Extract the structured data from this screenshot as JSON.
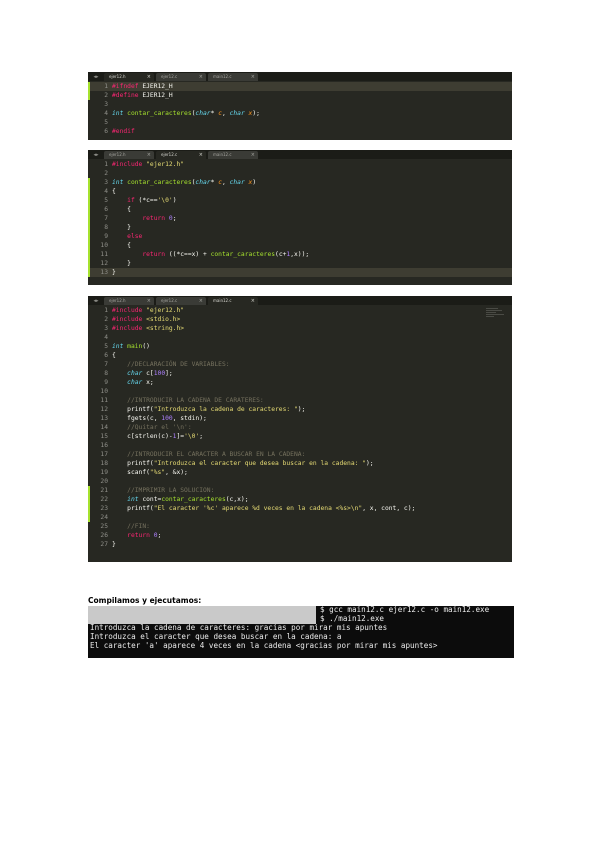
{
  "editors": [
    {
      "tabs": [
        {
          "label": "ejer12.h",
          "active": true
        },
        {
          "label": "ejer12.c",
          "active": false
        },
        {
          "label": "main12.c",
          "active": false
        }
      ],
      "lines": [
        {
          "n": "1",
          "tokens": [
            {
              "t": "#ifndef ",
              "c": "kw"
            },
            {
              "t": "EJER12_H",
              "c": ""
            }
          ]
        },
        {
          "n": "2",
          "tokens": [
            {
              "t": "#define ",
              "c": "kw"
            },
            {
              "t": "EJER12_H",
              "c": ""
            }
          ]
        },
        {
          "n": "3",
          "tokens": []
        },
        {
          "n": "4",
          "tokens": [
            {
              "t": "int ",
              "c": "ty"
            },
            {
              "t": "contar_caracteres",
              "c": "fn"
            },
            {
              "t": "(",
              "c": ""
            },
            {
              "t": "char",
              "c": "ty"
            },
            {
              "t": "* ",
              "c": ""
            },
            {
              "t": "c",
              "c": "pa"
            },
            {
              "t": ", ",
              "c": ""
            },
            {
              "t": "char ",
              "c": "ty"
            },
            {
              "t": "x",
              "c": "pa"
            },
            {
              "t": ");",
              "c": ""
            }
          ]
        },
        {
          "n": "5",
          "tokens": []
        },
        {
          "n": "6",
          "tokens": [
            {
              "t": "#endif",
              "c": "kw"
            }
          ]
        }
      ]
    },
    {
      "tabs": [
        {
          "label": "ejer12.h",
          "active": false
        },
        {
          "label": "ejer12.c",
          "active": true
        },
        {
          "label": "main12.c",
          "active": false
        }
      ],
      "lines": [
        {
          "n": "1",
          "tokens": [
            {
              "t": "#include ",
              "c": "kw"
            },
            {
              "t": "\"ejer12.h\"",
              "c": "st"
            }
          ]
        },
        {
          "n": "2",
          "tokens": []
        },
        {
          "n": "3",
          "tokens": [
            {
              "t": "int ",
              "c": "ty"
            },
            {
              "t": "contar_caracteres",
              "c": "fn"
            },
            {
              "t": "(",
              "c": ""
            },
            {
              "t": "char",
              "c": "ty"
            },
            {
              "t": "* ",
              "c": ""
            },
            {
              "t": "c",
              "c": "pa"
            },
            {
              "t": ", ",
              "c": ""
            },
            {
              "t": "char ",
              "c": "ty"
            },
            {
              "t": "x",
              "c": "pa"
            },
            {
              "t": ")",
              "c": ""
            }
          ]
        },
        {
          "n": "4",
          "tokens": [
            {
              "t": "{",
              "c": ""
            }
          ]
        },
        {
          "n": "5",
          "tokens": [
            {
              "t": "    ",
              "c": ""
            },
            {
              "t": "if ",
              "c": "kw"
            },
            {
              "t": "(*c==",
              "c": ""
            },
            {
              "t": "'\\0'",
              "c": "st"
            },
            {
              "t": ")",
              "c": ""
            }
          ]
        },
        {
          "n": "6",
          "tokens": [
            {
              "t": "    {",
              "c": ""
            }
          ]
        },
        {
          "n": "7",
          "tokens": [
            {
              "t": "        ",
              "c": ""
            },
            {
              "t": "return ",
              "c": "kw"
            },
            {
              "t": "0",
              "c": "nu"
            },
            {
              "t": ";",
              "c": ""
            }
          ]
        },
        {
          "n": "8",
          "tokens": [
            {
              "t": "    }",
              "c": ""
            }
          ]
        },
        {
          "n": "9",
          "tokens": [
            {
              "t": "    ",
              "c": ""
            },
            {
              "t": "else",
              "c": "kw"
            }
          ]
        },
        {
          "n": "10",
          "tokens": [
            {
              "t": "    {",
              "c": ""
            }
          ]
        },
        {
          "n": "11",
          "tokens": [
            {
              "t": "        ",
              "c": ""
            },
            {
              "t": "return ",
              "c": "kw"
            },
            {
              "t": "((*c==x) + ",
              "c": ""
            },
            {
              "t": "contar_caracteres",
              "c": "fn"
            },
            {
              "t": "(c+",
              "c": ""
            },
            {
              "t": "1",
              "c": "nu"
            },
            {
              "t": ",x));",
              "c": ""
            }
          ]
        },
        {
          "n": "12",
          "tokens": [
            {
              "t": "    }",
              "c": ""
            }
          ]
        },
        {
          "n": "13",
          "tokens": [
            {
              "t": "}",
              "c": ""
            }
          ]
        }
      ]
    },
    {
      "tabs": [
        {
          "label": "ejer12.h",
          "active": false
        },
        {
          "label": "ejer12.c",
          "active": false
        },
        {
          "label": "main12.c",
          "active": true
        }
      ],
      "lines": [
        {
          "n": "1",
          "tokens": [
            {
              "t": "#include ",
              "c": "kw"
            },
            {
              "t": "\"ejer12.h\"",
              "c": "st"
            }
          ]
        },
        {
          "n": "2",
          "tokens": [
            {
              "t": "#include ",
              "c": "kw"
            },
            {
              "t": "<stdio.h>",
              "c": "st"
            }
          ]
        },
        {
          "n": "3",
          "tokens": [
            {
              "t": "#include ",
              "c": "kw"
            },
            {
              "t": "<string.h>",
              "c": "st"
            }
          ]
        },
        {
          "n": "4",
          "tokens": []
        },
        {
          "n": "5",
          "tokens": [
            {
              "t": "int ",
              "c": "ty"
            },
            {
              "t": "main",
              "c": "fn"
            },
            {
              "t": "()",
              "c": ""
            }
          ]
        },
        {
          "n": "6",
          "tokens": [
            {
              "t": "{",
              "c": ""
            }
          ]
        },
        {
          "n": "7",
          "tokens": [
            {
              "t": "    ",
              "c": ""
            },
            {
              "t": "//DECLARACIÓN DE VARIABLES:",
              "c": "cm"
            }
          ]
        },
        {
          "n": "8",
          "tokens": [
            {
              "t": "    ",
              "c": ""
            },
            {
              "t": "char ",
              "c": "ty"
            },
            {
              "t": "c[",
              "c": ""
            },
            {
              "t": "100",
              "c": "nu"
            },
            {
              "t": "];",
              "c": ""
            }
          ]
        },
        {
          "n": "9",
          "tokens": [
            {
              "t": "    ",
              "c": ""
            },
            {
              "t": "char ",
              "c": "ty"
            },
            {
              "t": "x;",
              "c": ""
            }
          ]
        },
        {
          "n": "10",
          "tokens": []
        },
        {
          "n": "11",
          "tokens": [
            {
              "t": "    ",
              "c": ""
            },
            {
              "t": "//INTRODUCIR LA CADENA DE CARATERES:",
              "c": "cm"
            }
          ]
        },
        {
          "n": "12",
          "tokens": [
            {
              "t": "    printf(",
              "c": ""
            },
            {
              "t": "\"Introduzca la cadena de caracteres: \"",
              "c": "st"
            },
            {
              "t": ");",
              "c": ""
            }
          ]
        },
        {
          "n": "13",
          "tokens": [
            {
              "t": "    fgets(c, ",
              "c": ""
            },
            {
              "t": "100",
              "c": "nu"
            },
            {
              "t": ", stdin);",
              "c": ""
            }
          ]
        },
        {
          "n": "14",
          "tokens": [
            {
              "t": "    ",
              "c": ""
            },
            {
              "t": "//Quitar el '\\n':",
              "c": "cm"
            }
          ]
        },
        {
          "n": "15",
          "tokens": [
            {
              "t": "    c[strlen(c)-",
              "c": ""
            },
            {
              "t": "1",
              "c": "nu"
            },
            {
              "t": "]=",
              "c": ""
            },
            {
              "t": "'\\0'",
              "c": "st"
            },
            {
              "t": ";",
              "c": ""
            }
          ]
        },
        {
          "n": "16",
          "tokens": []
        },
        {
          "n": "17",
          "tokens": [
            {
              "t": "    ",
              "c": ""
            },
            {
              "t": "//INTRODUCIR EL CARACTER A BUSCAR EN LA CADENA:",
              "c": "cm"
            }
          ]
        },
        {
          "n": "18",
          "tokens": [
            {
              "t": "    printf(",
              "c": ""
            },
            {
              "t": "\"Introduzca el caracter que desea buscar en la cadena: \"",
              "c": "st"
            },
            {
              "t": ");",
              "c": ""
            }
          ]
        },
        {
          "n": "19",
          "tokens": [
            {
              "t": "    scanf(",
              "c": ""
            },
            {
              "t": "\"%s\"",
              "c": "st"
            },
            {
              "t": ", &x);",
              "c": ""
            }
          ]
        },
        {
          "n": "20",
          "tokens": []
        },
        {
          "n": "21",
          "tokens": [
            {
              "t": "    ",
              "c": ""
            },
            {
              "t": "//IMPRIMIR LA SOLUCION:",
              "c": "cm"
            }
          ]
        },
        {
          "n": "22",
          "tokens": [
            {
              "t": "    ",
              "c": ""
            },
            {
              "t": "int ",
              "c": "ty"
            },
            {
              "t": "cont=",
              "c": ""
            },
            {
              "t": "contar_caracteres",
              "c": "fn"
            },
            {
              "t": "(c,x);",
              "c": ""
            }
          ]
        },
        {
          "n": "23",
          "tokens": [
            {
              "t": "    printf(",
              "c": ""
            },
            {
              "t": "\"El caracter '%c' aparece %d veces en la cadena <%s>\\n\"",
              "c": "st"
            },
            {
              "t": ", x, cont, c);",
              "c": ""
            }
          ]
        },
        {
          "n": "24",
          "tokens": []
        },
        {
          "n": "25",
          "tokens": [
            {
              "t": "    ",
              "c": ""
            },
            {
              "t": "//FIN:",
              "c": "cm"
            }
          ]
        },
        {
          "n": "26",
          "tokens": [
            {
              "t": "    ",
              "c": ""
            },
            {
              "t": "return ",
              "c": "kw"
            },
            {
              "t": "0",
              "c": "nu"
            },
            {
              "t": ";",
              "c": ""
            }
          ]
        },
        {
          "n": "27",
          "tokens": [
            {
              "t": "}",
              "c": ""
            }
          ]
        }
      ]
    }
  ],
  "caption": "Compilamos y ejecutamos:",
  "terminal": {
    "prompt_lines": [
      "$ gcc main12.c ejer12.c -o main12.exe",
      "$ ./main12.exe"
    ],
    "output_lines": [
      "Introduzca la cadena de caracteres: gracias por mirar mis apuntes",
      "Introduzca el caracter que desea buscar en la cadena: a",
      "El caracter 'a' aparece 4 veces en la cadena <gracias por mirar mis apuntes>"
    ]
  },
  "colors": {
    "editor_bg": "#272822",
    "keyword": "#f92672",
    "type": "#66d9ef",
    "function": "#a6e22e",
    "string": "#e6db74",
    "number": "#ae81ff",
    "comment": "#75715e",
    "terminal_bg": "#0c0c0c"
  }
}
